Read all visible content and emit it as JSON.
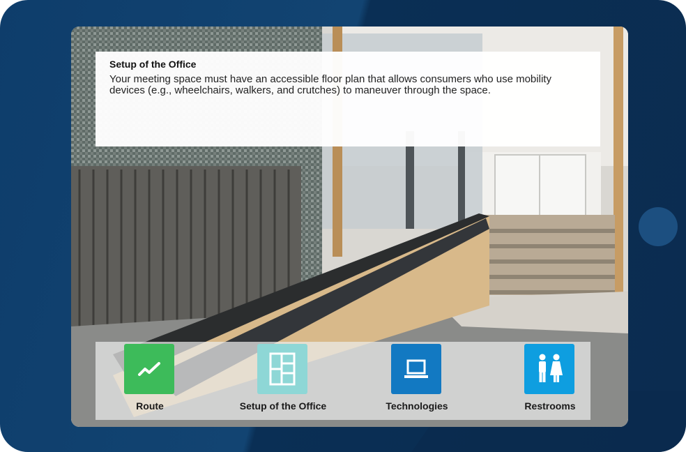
{
  "info": {
    "title": "Setup of the Office",
    "body": "Your meeting space must have an accessible floor plan that allows consumers who use mobility devices (e.g., wheelchairs, walkers, and crutches) to maneuver through the space."
  },
  "nav": {
    "items": [
      {
        "label": "Route",
        "icon": "trend-line-icon",
        "color": "#3dbb5a"
      },
      {
        "label": "Setup of the Office",
        "icon": "floor-plan-icon",
        "color": "#8ed7d6"
      },
      {
        "label": "Technologies",
        "icon": "laptop-icon",
        "color": "#1279c2"
      },
      {
        "label": "Restrooms",
        "icon": "restroom-icon",
        "color": "#0e9ee0"
      }
    ]
  }
}
